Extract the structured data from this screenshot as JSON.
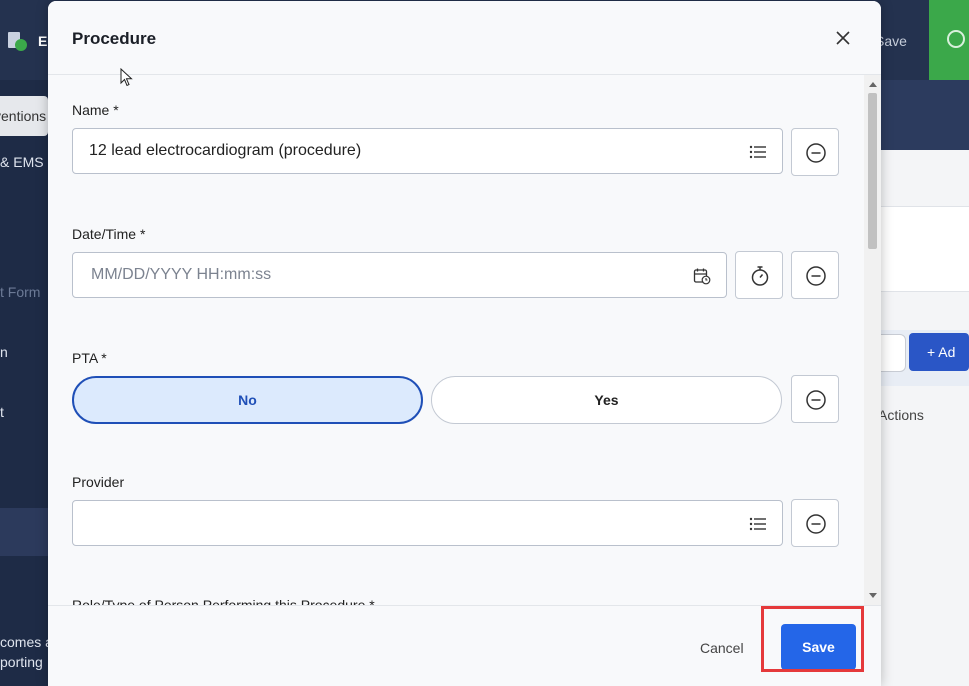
{
  "background": {
    "header_label": "E",
    "save_label": "Save",
    "tab_label": "ventions",
    "sidebar_texts": [
      "& EMS",
      "t Form",
      "n",
      "t",
      "comes a",
      "porting"
    ],
    "add_label": "+ Ad",
    "actions_label": "Actions"
  },
  "modal": {
    "title": "Procedure",
    "fields": {
      "name": {
        "label": "Name  *",
        "value": "12 lead electrocardiogram (procedure)"
      },
      "datetime": {
        "label": "Date/Time  *",
        "placeholder": "MM/DD/YYYY HH:mm:ss"
      },
      "pta": {
        "label": "PTA  *",
        "options": [
          "No",
          "Yes"
        ],
        "selected": "No"
      },
      "provider": {
        "label": "Provider",
        "value": ""
      },
      "role": {
        "label": "Role/Type of Person Performing this Procedure  *"
      }
    },
    "footer": {
      "cancel_label": "Cancel",
      "save_label": "Save"
    }
  },
  "colors": {
    "primary": "#2466e8",
    "selected_toggle_bg": "#dceafd",
    "selected_toggle_border": "#1f4fb7",
    "highlight": "#e5393b"
  }
}
